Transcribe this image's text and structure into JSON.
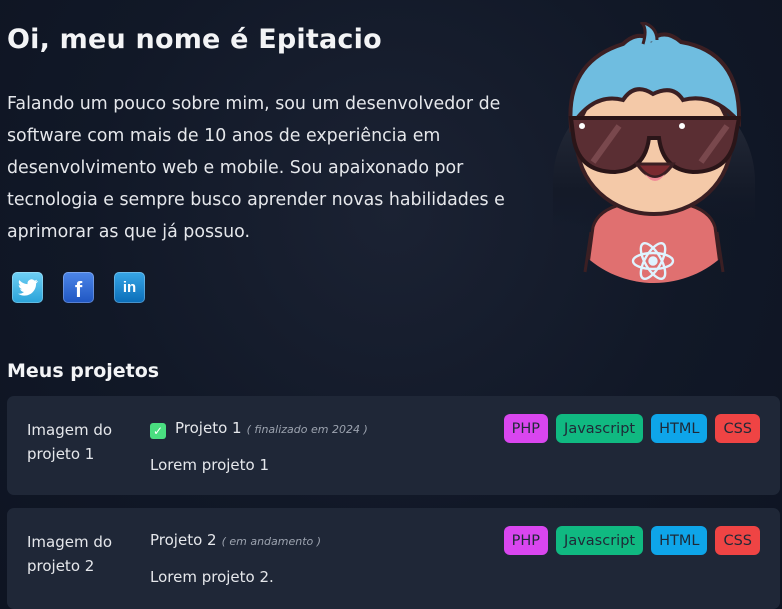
{
  "hero": {
    "title": "Oi, meu nome é Epitacio",
    "bio": "Falando um pouco sobre mim, sou um desenvolvedor de software com mais de 10 anos de experiência em desenvolvimento web e mobile. Sou apaixonado por tecnologia e sempre busco aprender novas habilidades e aprimorar as que já possuo."
  },
  "socials": [
    {
      "name": "twitter",
      "icon": "twitter-icon"
    },
    {
      "name": "facebook",
      "icon": "facebook-icon",
      "glyph": "f"
    },
    {
      "name": "linkedin",
      "icon": "linkedin-icon",
      "glyph": "in"
    }
  ],
  "projects_section": {
    "title": "Meus projetos",
    "items": [
      {
        "image_alt": "Imagem do projeto 1",
        "name": "Projeto 1",
        "status": "( finalizado em 2024 )",
        "completed": true,
        "description": "Lorem projeto 1",
        "tags": [
          "PHP",
          "Javascript",
          "HTML",
          "CSS"
        ]
      },
      {
        "image_alt": "Imagem do projeto 2",
        "name": "Projeto 2",
        "status": "( em andamento )",
        "completed": false,
        "description": "Lorem projeto 2.",
        "tags": [
          "PHP",
          "Javascript",
          "HTML",
          "CSS"
        ]
      }
    ]
  },
  "tag_colors": {
    "PHP": "#d946ef",
    "Javascript": "#10b981",
    "HTML": "#0ea5e9",
    "CSS": "#ef4444"
  },
  "check_glyph": "✓"
}
